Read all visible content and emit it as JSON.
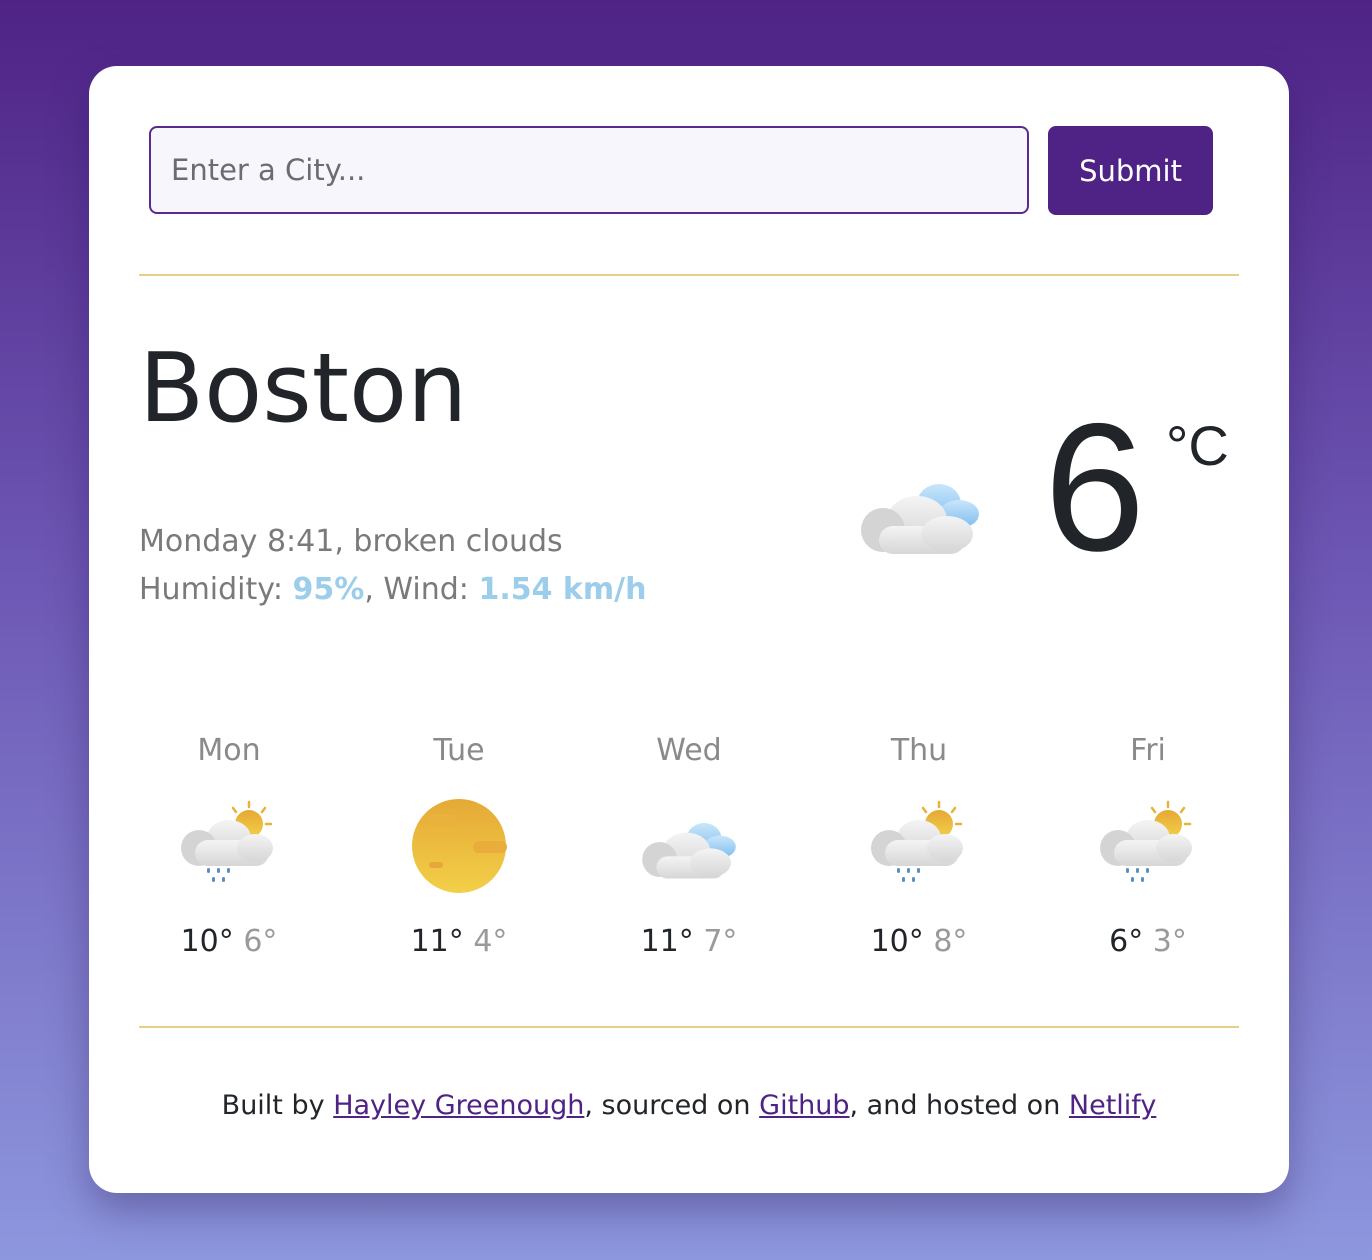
{
  "search": {
    "placeholder": "Enter a City...",
    "submit_label": "Submit"
  },
  "current": {
    "city": "Boston",
    "day_time": "Monday 8:41",
    "condition": "broken clouds",
    "humidity_label": "Humidity:",
    "humidity_value": "95%",
    "wind_label": "Wind:",
    "wind_value": "1.54 km/h",
    "temperature": "6",
    "unit": "°C",
    "icon": "broken-clouds-icon"
  },
  "forecast": [
    {
      "day": "Mon",
      "max": "10°",
      "min": "6°",
      "icon": "rain-sun-cloud-icon"
    },
    {
      "day": "Tue",
      "max": "11°",
      "min": "4°",
      "icon": "sun-icon"
    },
    {
      "day": "Wed",
      "max": "11°",
      "min": "7°",
      "icon": "clouds-icon"
    },
    {
      "day": "Thu",
      "max": "10°",
      "min": "8°",
      "icon": "rain-sun-cloud-icon"
    },
    {
      "day": "Fri",
      "max": "6°",
      "min": "3°",
      "icon": "rain-sun-cloud-icon"
    }
  ],
  "footer": {
    "prefix": "Built by",
    "author": "Hayley Greenough",
    "middle": ", sourced on",
    "source": "Github",
    "middle2": ", and hosted on",
    "host": "Netlify"
  },
  "colors": {
    "accent": "#4f2386",
    "highlight": "#9ccdea",
    "divider": "#e6cf87",
    "text": "#212529",
    "muted": "#7a7a7a"
  }
}
